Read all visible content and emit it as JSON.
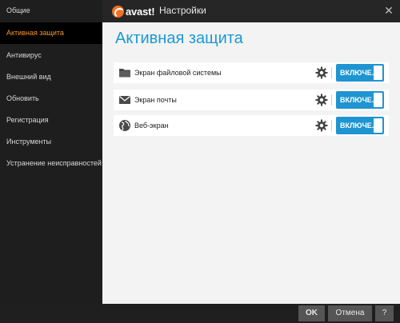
{
  "window": {
    "brand": "avast!",
    "title": "Настройки"
  },
  "sidebar": {
    "items": [
      {
        "label": "Общие",
        "active": false
      },
      {
        "label": "Активная защита",
        "active": true
      },
      {
        "label": "Антивирус",
        "active": false
      },
      {
        "label": "Внешний вид",
        "active": false
      },
      {
        "label": "Обновить",
        "active": false
      },
      {
        "label": "Регистрация",
        "active": false
      },
      {
        "label": "Инструменты",
        "active": false
      },
      {
        "label": "Устранение неисправностей",
        "active": false
      }
    ]
  },
  "main": {
    "heading": "Активная защита",
    "shields": [
      {
        "label": "Экран файловой системы",
        "icon": "folder-icon",
        "state": "ВКЛЮЧЕ..."
      },
      {
        "label": "Экран почты",
        "icon": "mail-icon",
        "state": "ВКЛЮЧЕ..."
      },
      {
        "label": "Веб-экран",
        "icon": "globe-icon",
        "state": "ВКЛЮЧЕ..."
      }
    ]
  },
  "footer": {
    "ok": "OK",
    "cancel": "Отмена",
    "help": "?"
  },
  "colors": {
    "accent": "#1999d5",
    "active_nav": "#f7942b",
    "toggle_on": "#1e95d1"
  }
}
